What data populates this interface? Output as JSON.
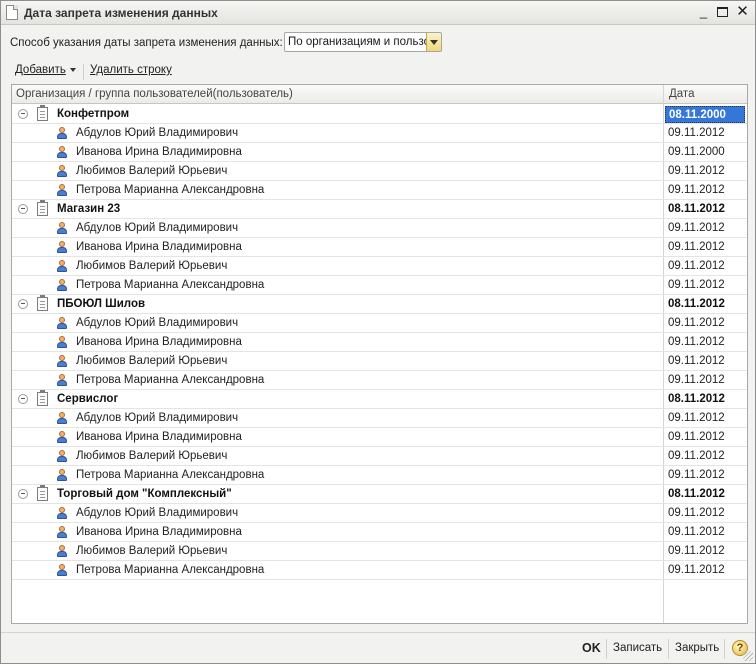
{
  "window": {
    "title": "Дата запрета изменения данных",
    "minimize_label": "_",
    "close_label": "✕"
  },
  "method": {
    "label": "Способ указания даты запрета изменения данных:",
    "selected": "По организациям и пользо"
  },
  "toolbar": {
    "add_label": "Добавить",
    "delete_label": "Удалить строку"
  },
  "grid": {
    "col_org_header": "Организация / группа пользователей(пользователь)",
    "col_date_header": "Дата",
    "groups": [
      {
        "name": "Конфетпром",
        "date": "08.11.2000",
        "users": [
          {
            "name": "Абдулов Юрий Владимирович",
            "date": "09.11.2012"
          },
          {
            "name": "Иванова Ирина Владимировна",
            "date": "09.11.2000"
          },
          {
            "name": "Любимов Валерий Юрьевич",
            "date": "09.11.2012"
          },
          {
            "name": "Петрова Марианна Александровна",
            "date": "09.11.2012"
          }
        ]
      },
      {
        "name": "Магазин 23",
        "date": "08.11.2012",
        "users": [
          {
            "name": "Абдулов Юрий Владимирович",
            "date": "09.11.2012"
          },
          {
            "name": "Иванова Ирина Владимировна",
            "date": "09.11.2012"
          },
          {
            "name": "Любимов Валерий Юрьевич",
            "date": "09.11.2012"
          },
          {
            "name": "Петрова Марианна Александровна",
            "date": "09.11.2012"
          }
        ]
      },
      {
        "name": "ПБОЮЛ  Шилов",
        "date": "08.11.2012",
        "users": [
          {
            "name": "Абдулов Юрий Владимирович",
            "date": "09.11.2012"
          },
          {
            "name": "Иванова Ирина Владимировна",
            "date": "09.11.2012"
          },
          {
            "name": "Любимов Валерий Юрьевич",
            "date": "09.11.2012"
          },
          {
            "name": "Петрова Марианна Александровна",
            "date": "09.11.2012"
          }
        ]
      },
      {
        "name": "Сервислог",
        "date": "08.11.2012",
        "users": [
          {
            "name": "Абдулов Юрий Владимирович",
            "date": "09.11.2012"
          },
          {
            "name": "Иванова Ирина Владимировна",
            "date": "09.11.2012"
          },
          {
            "name": "Любимов Валерий Юрьевич",
            "date": "09.11.2012"
          },
          {
            "name": "Петрова Марианна Александровна",
            "date": "09.11.2012"
          }
        ]
      },
      {
        "name": "Торговый дом \"Комплексный\"",
        "date": "08.11.2012",
        "users": [
          {
            "name": "Абдулов Юрий Владимирович",
            "date": "09.11.2012"
          },
          {
            "name": "Иванова Ирина Владимировна",
            "date": "09.11.2012"
          },
          {
            "name": "Любимов Валерий Юрьевич",
            "date": "09.11.2012"
          },
          {
            "name": "Петрова Марианна Александровна",
            "date": "09.11.2012"
          }
        ]
      }
    ]
  },
  "footer": {
    "ok_label": "OK",
    "save_label": "Записать",
    "close_label": "Закрыть",
    "help_label": "?"
  },
  "colors": {
    "selection": "#3477d9",
    "accent_dropdown": "#f0d77c"
  },
  "icons": {
    "org": "document-list-icon",
    "user": "user-icon",
    "group_toggle": "collapse-icon",
    "help": "help-icon"
  }
}
